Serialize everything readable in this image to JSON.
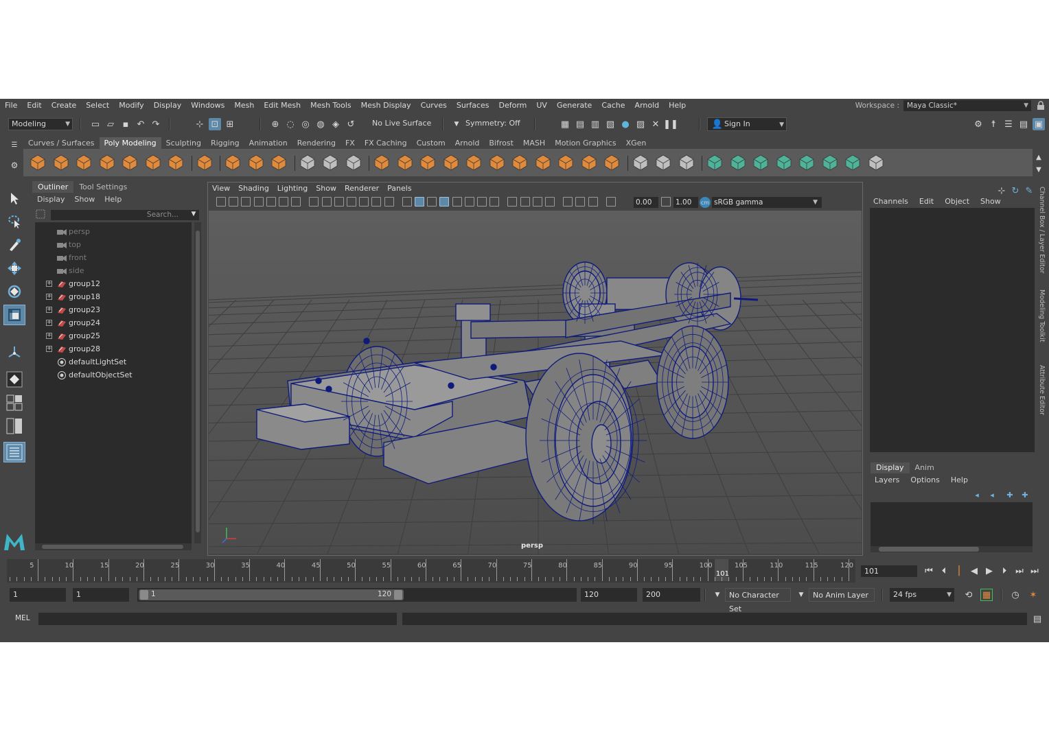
{
  "menubar": [
    "File",
    "Edit",
    "Create",
    "Select",
    "Modify",
    "Display",
    "Windows",
    "Mesh",
    "Edit Mesh",
    "Mesh Tools",
    "Mesh Display",
    "Curves",
    "Surfaces",
    "Deform",
    "UV",
    "Generate",
    "Cache",
    "Arnold",
    "Help"
  ],
  "workspace": {
    "label": "Workspace :",
    "value": "Maya Classic*"
  },
  "status": {
    "mode": "Modeling",
    "live_surface": "No Live Surface",
    "symmetry": "Symmetry: Off",
    "sign_in": "Sign In"
  },
  "shelf_tabs": [
    "Curves / Surfaces",
    "Poly Modeling",
    "Sculpting",
    "Rigging",
    "Animation",
    "Rendering",
    "FX",
    "FX Caching",
    "Custom",
    "Arnold",
    "Bifrost",
    "MASH",
    "Motion Graphics",
    "XGen"
  ],
  "shelf_active": "Poly Modeling",
  "outliner": {
    "tabs": [
      "Outliner",
      "Tool Settings"
    ],
    "menu": [
      "Display",
      "Show",
      "Help"
    ],
    "search_placeholder": "Search...",
    "items": [
      {
        "label": "persp",
        "kind": "camera",
        "dim": true
      },
      {
        "label": "top",
        "kind": "camera",
        "dim": true
      },
      {
        "label": "front",
        "kind": "camera",
        "dim": true
      },
      {
        "label": "side",
        "kind": "camera",
        "dim": true
      },
      {
        "label": "group12",
        "kind": "group",
        "dim": false
      },
      {
        "label": "group18",
        "kind": "group",
        "dim": false
      },
      {
        "label": "group23",
        "kind": "group",
        "dim": false
      },
      {
        "label": "group24",
        "kind": "group",
        "dim": false
      },
      {
        "label": "group25",
        "kind": "group",
        "dim": false
      },
      {
        "label": "group28",
        "kind": "group",
        "dim": false
      },
      {
        "label": "defaultLightSet",
        "kind": "set",
        "dim": false
      },
      {
        "label": "defaultObjectSet",
        "kind": "set",
        "dim": false
      }
    ]
  },
  "viewport": {
    "menu": [
      "View",
      "Shading",
      "Lighting",
      "Show",
      "Renderer",
      "Panels"
    ],
    "exposure": "0.00",
    "gamma": "1.00",
    "color_space": "sRGB gamma",
    "camera_label": "persp"
  },
  "channel_box": {
    "menu": [
      "Channels",
      "Edit",
      "Object",
      "Show"
    ]
  },
  "side_tabs": [
    "Channel Box / Layer Editor",
    "Modeling Toolkit",
    "Attribute Editor"
  ],
  "layer_editor": {
    "tabs": [
      "Display",
      "Anim"
    ],
    "menu": [
      "Layers",
      "Options",
      "Help"
    ]
  },
  "time": {
    "ticks": [
      "5",
      "10",
      "15",
      "20",
      "25",
      "30",
      "35",
      "40",
      "45",
      "50",
      "55",
      "60",
      "65",
      "70",
      "75",
      "80",
      "85",
      "90",
      "95",
      "100",
      "105",
      "110",
      "115",
      "120"
    ],
    "current_frame": "101",
    "current_field": "101"
  },
  "range": {
    "start": "1",
    "playback_start": "1",
    "slider_start": "1",
    "slider_end": "120",
    "playback_end": "120",
    "end": "200",
    "character_set": "No Character Set",
    "anim_layer": "No Anim Layer",
    "fps": "24 fps"
  },
  "command_line": {
    "label": "MEL"
  },
  "colors": {
    "accent": "#5d88a8",
    "shelf_icon": "#e08a3c",
    "shelf_icon_green": "#4fb39a",
    "wire": "#101b7a"
  }
}
